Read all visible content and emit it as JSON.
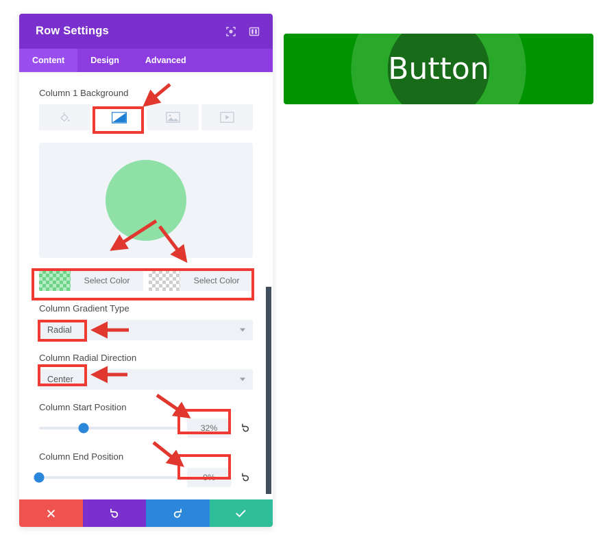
{
  "panel": {
    "title": "Row Settings",
    "header_icons": [
      {
        "name": "expand-icon",
        "glyph": "expand"
      },
      {
        "name": "layout-icon",
        "glyph": "layout"
      }
    ],
    "tabs": [
      {
        "label": "Content",
        "active": true
      },
      {
        "label": "Design",
        "active": false
      },
      {
        "label": "Advanced",
        "active": false
      }
    ],
    "fields": {
      "background_label": "Column 1 Background",
      "background_types": [
        {
          "name": "color-fill-icon",
          "active": false
        },
        {
          "name": "gradient-icon",
          "active": true
        },
        {
          "name": "image-icon",
          "active": false
        },
        {
          "name": "video-icon",
          "active": false
        }
      ],
      "color_left": {
        "label": "Select Color",
        "swatch": "green"
      },
      "color_right": {
        "label": "Select Color",
        "swatch": "transparent"
      },
      "gradient_type": {
        "label": "Column Gradient Type",
        "value": "Radial"
      },
      "radial_direction": {
        "label": "Column Radial Direction",
        "value": "Center"
      },
      "start_position": {
        "label": "Column Start Position",
        "value": "32%",
        "percent": 32
      },
      "end_position": {
        "label": "Column End Position",
        "value": "0%",
        "percent": 0
      }
    },
    "footer": [
      {
        "name": "close-button",
        "glyph": "close",
        "color": "#ef5350"
      },
      {
        "name": "undo-button",
        "glyph": "undo",
        "color": "#7a30cc"
      },
      {
        "name": "redo-button",
        "glyph": "redo",
        "color": "#2b87da"
      },
      {
        "name": "save-button",
        "glyph": "check",
        "color": "#2fbd9a"
      }
    ]
  },
  "preview": {
    "button_label": "Button",
    "gradient_center_color": "#186b18",
    "gradient_mid_color": "#2aa82a",
    "gradient_outer_color": "#009500"
  },
  "colors": {
    "panel_header": "#7a30cc",
    "tab_bar": "#8c3ce0",
    "tab_active": "#9b4ef0",
    "annotation_red": "#ef3b32",
    "slider_accent": "#2b87da",
    "preview_circle_green": "#8ee0a5"
  }
}
